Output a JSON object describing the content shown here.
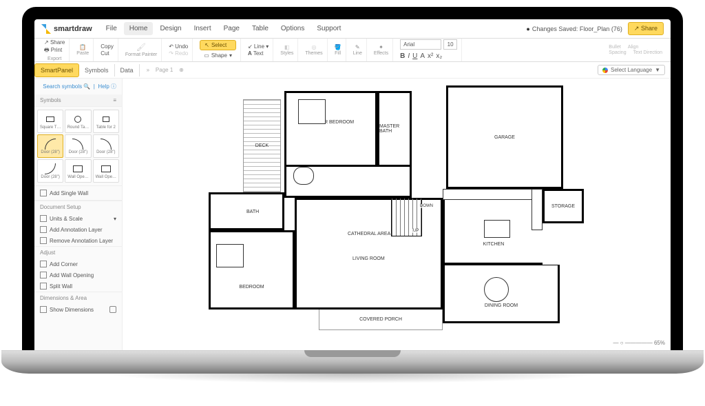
{
  "brand": "smartdraw",
  "menu": [
    "File",
    "Home",
    "Design",
    "Insert",
    "Page",
    "Table",
    "Options",
    "Support"
  ],
  "menu_active": 1,
  "save_status": "Changes Saved: Floor_Plan (76)",
  "share_btn": "Share",
  "ribbon": {
    "export_share": "Share",
    "export_print": "Print",
    "export_label": "Export",
    "paste": "Paste",
    "copy": "Copy",
    "cut": "Cut",
    "format_painter": "Format Painter",
    "undo": "Undo",
    "redo": "Redo",
    "select": "Select",
    "shape": "Shape",
    "line": "Line",
    "text": "Text",
    "styles": "Styles",
    "themes": "Themes",
    "fill": "Fill",
    "line2": "Line",
    "effects": "Effects",
    "font_name": "Arial",
    "font_size": "10",
    "bullet": "Bullet",
    "spacing": "Spacing",
    "align": "Align",
    "direction": "Text Direction"
  },
  "tabs": {
    "smartpanel": "SmartPanel",
    "symbols": "Symbols",
    "data": "Data",
    "page": "Page 1"
  },
  "lang_btn": "Select Language",
  "sidebar": {
    "search": "Search symbols",
    "help": "Help",
    "symbols_head": "Symbols",
    "symbols": [
      "Square T…",
      "Round Ta…",
      "Table for 2",
      "Door (28\")",
      "Door (28\")",
      "Door (28\")",
      "Door (28\")",
      "Wall Ope…",
      "Wall Ope…"
    ],
    "add_wall": "Add Single Wall",
    "doc_setup": "Document Setup",
    "units_scale": "Units & Scale",
    "add_anno": "Add Annotation Layer",
    "remove_anno": "Remove Annotation Layer",
    "adjust": "Adjust",
    "add_corner": "Add Corner",
    "add_wall_open": "Add Wall Opening",
    "split_wall": "Split Wall",
    "dims": "Dimensions & Area",
    "show_dims": "Show Dimensions"
  },
  "plan": {
    "deck": "DECK",
    "master_bed": "MASTER BEDROOM",
    "master_bath": "MASTER BATH",
    "garage": "GARAGE",
    "storage": "STORAGE",
    "bath": "BATH",
    "down": "DOWN",
    "up": "UP",
    "cathedral": "CATHEDRAL AREA",
    "bedroom": "BEDROOM",
    "living": "LIVING ROOM",
    "kitchen": "KITCHEN",
    "dining": "DINING ROOM",
    "covered_porch": "COVERED PORCH"
  },
  "zoom": "65%"
}
